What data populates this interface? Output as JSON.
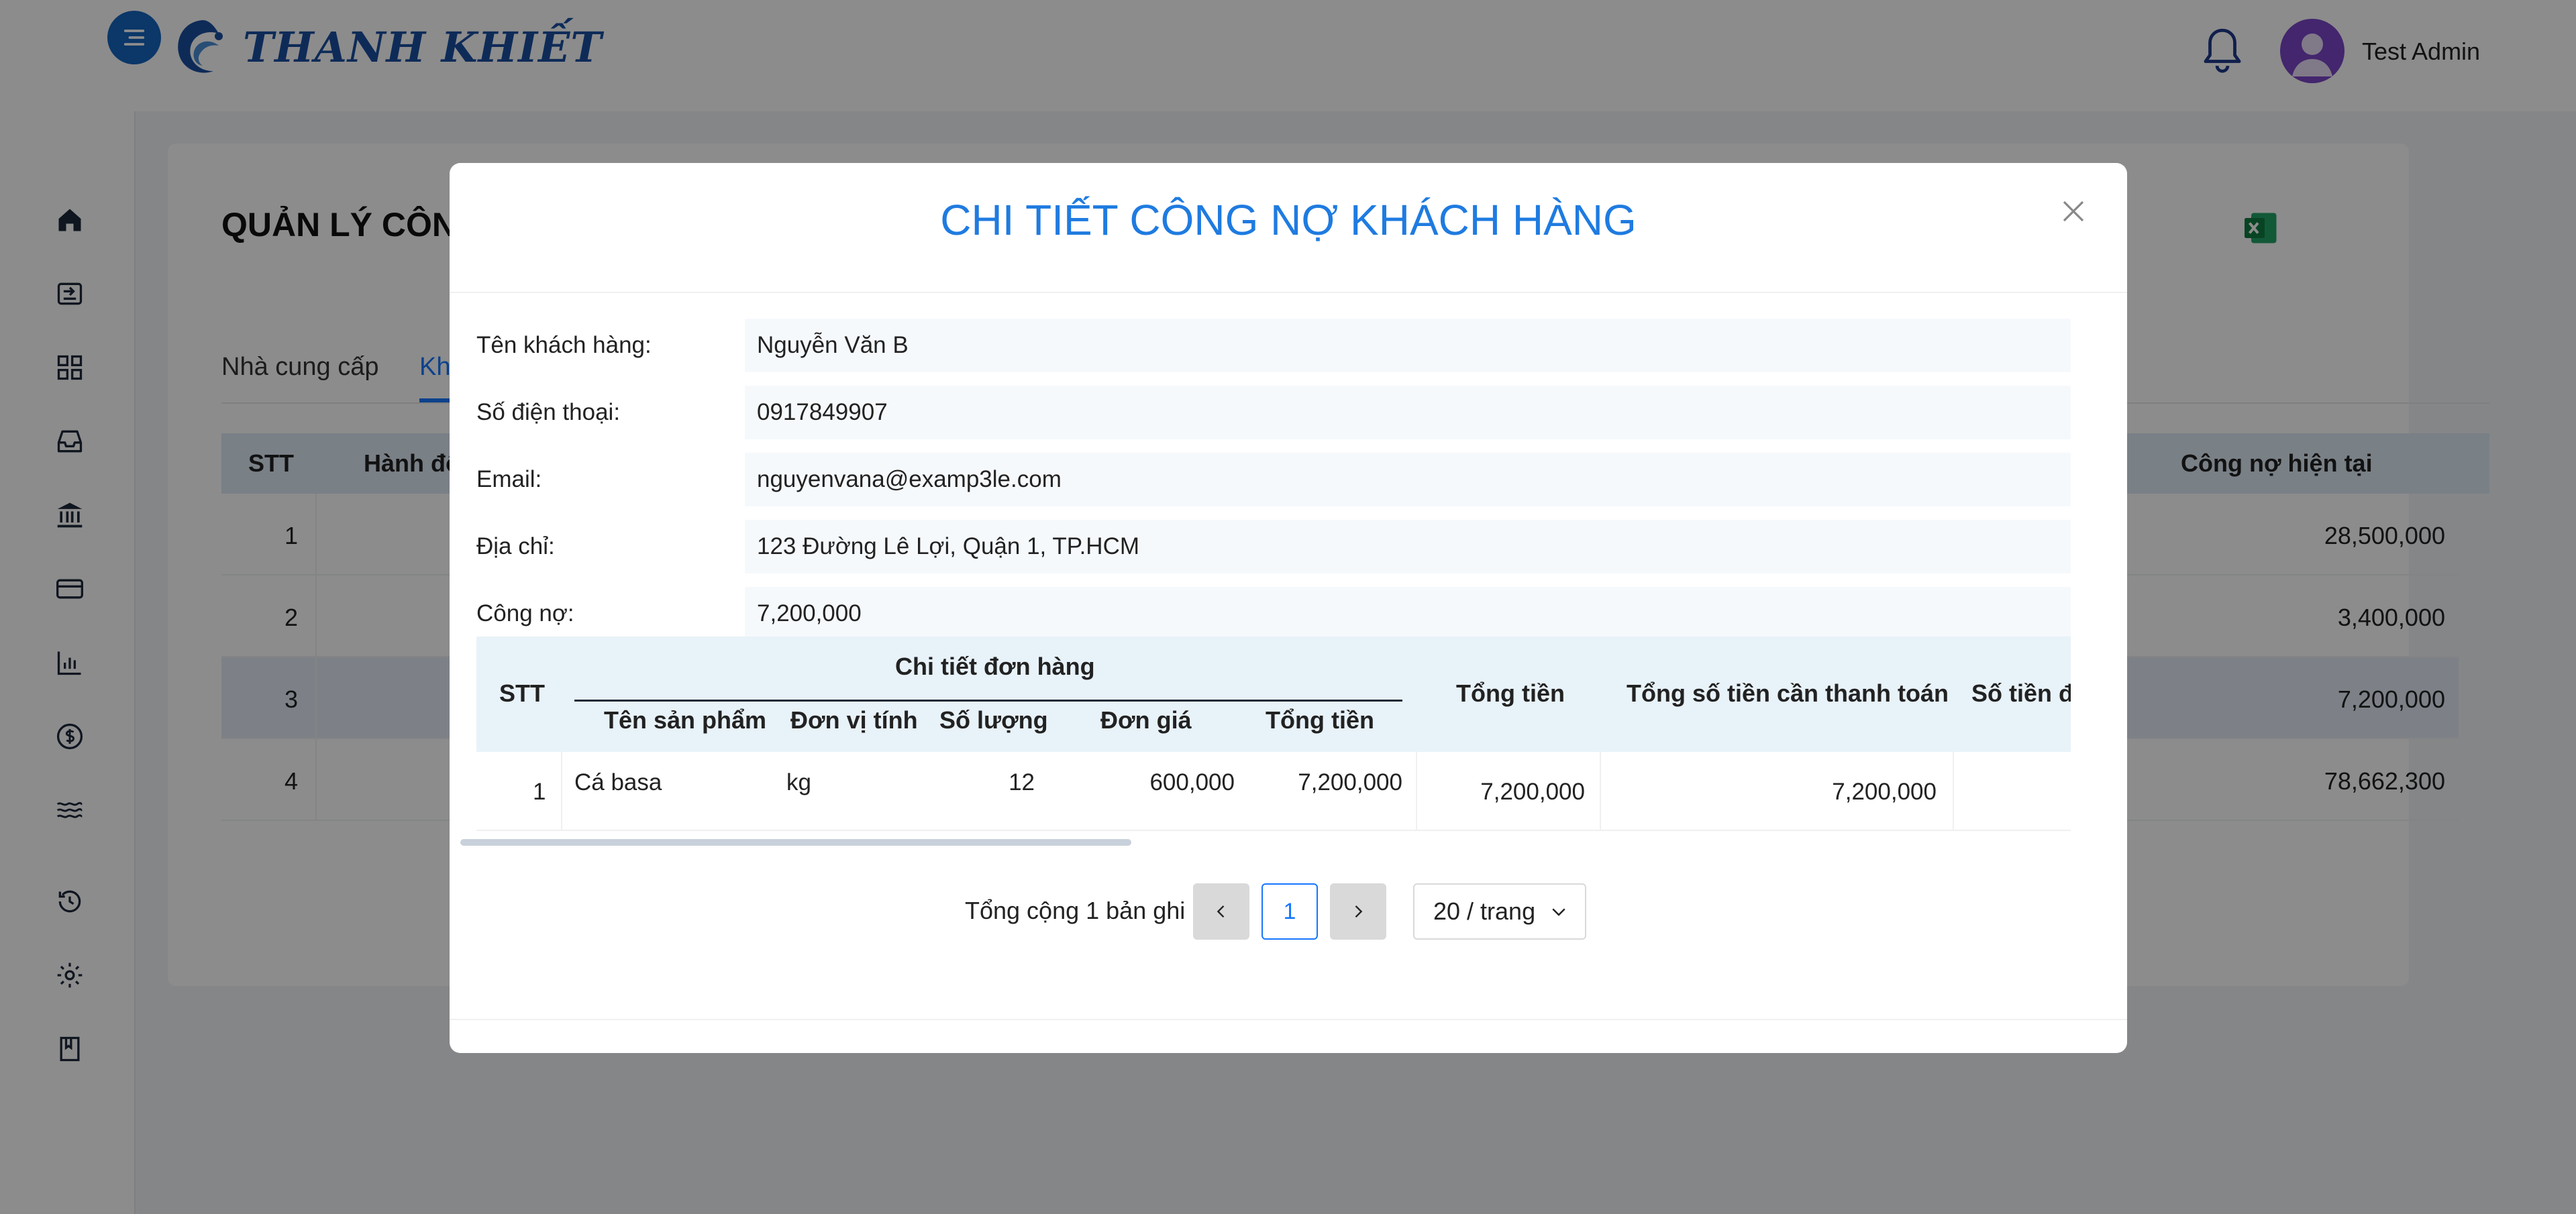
{
  "header": {
    "brand": "THANH KHIẾT",
    "user_name": "Test Admin",
    "icons": [
      "menu-icon",
      "bell-icon",
      "avatar-icon"
    ]
  },
  "sidebar": {
    "icons": [
      "home-icon",
      "import-icon",
      "grid-icon",
      "inbox-icon",
      "bank-icon",
      "card-icon",
      "chart-icon",
      "dollar-icon",
      "waves-icon",
      "history-icon",
      "gear-icon",
      "book-icon"
    ]
  },
  "page": {
    "title": "QUẢN LÝ CÔN",
    "tabs": [
      "Nhà cung cấp",
      "Kha"
    ],
    "table_headers": {
      "stt": "STT",
      "action": "Hành độ",
      "current_debt": "Công nợ hiện tại"
    },
    "rows": [
      {
        "stt": "1",
        "debt": "28,500,000"
      },
      {
        "stt": "2",
        "debt": "3,400,000"
      },
      {
        "stt": "3",
        "debt": "7,200,000"
      },
      {
        "stt": "4",
        "debt": "78,662,300"
      }
    ]
  },
  "modal": {
    "title": "CHI TIẾT CÔNG NỢ KHÁCH HÀNG",
    "fields": [
      {
        "label": "Tên khách hàng:",
        "value": "Nguyễn Văn B"
      },
      {
        "label": "Số điện thoại:",
        "value": "0917849907"
      },
      {
        "label": "Email:",
        "value": "nguyenvana@examp3le.com"
      },
      {
        "label": "Địa chỉ:",
        "value": "123 Đường Lê Lợi, Quận 1, TP.HCM"
      },
      {
        "label": "Công nợ:",
        "value": "7,200,000"
      }
    ],
    "table": {
      "headers": {
        "stt": "STT",
        "group": "Chi tiết đơn hàng",
        "product": "Tên sản phẩm",
        "unit": "Đơn vị tính",
        "qty": "Số lượng",
        "price": "Đơn giá",
        "line_total": "Tổng tiền",
        "total": "Tổng tiền",
        "to_pay": "Tổng số tiền cần thanh toán",
        "paid": "Số tiền đã"
      },
      "rows": [
        {
          "stt": "1",
          "product": "Cá basa",
          "unit": "kg",
          "qty": "12",
          "price": "600,000",
          "line_total": "7,200,000",
          "total": "7,200,000",
          "to_pay": "7,200,000"
        }
      ]
    },
    "pagination": {
      "total_text": "Tổng cộng 1 bản ghi",
      "current_page": "1",
      "page_size": "20 / trang"
    }
  }
}
